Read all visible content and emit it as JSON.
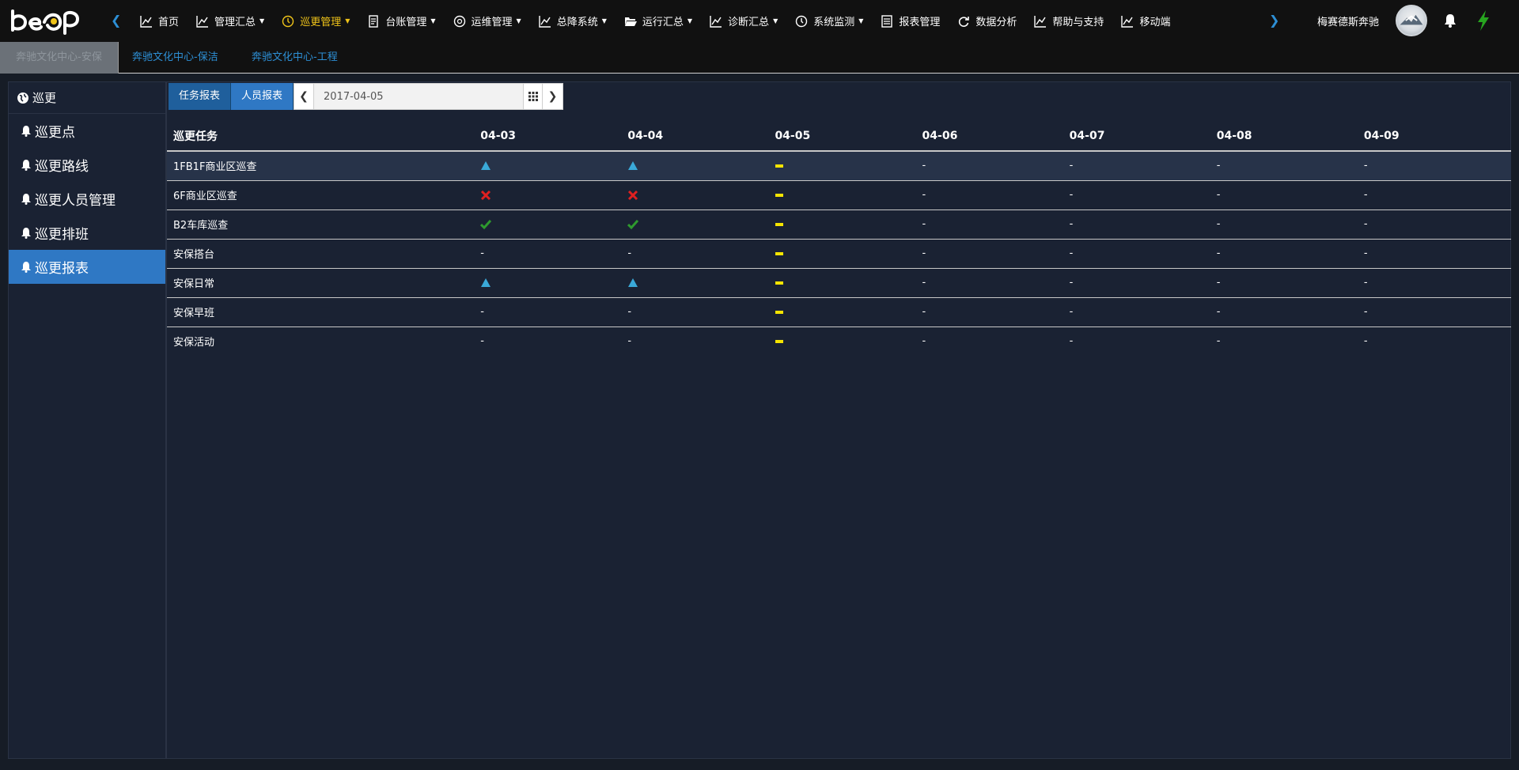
{
  "nav": {
    "items": [
      {
        "label": "首页",
        "icon": "chart-line-icon",
        "caret": false,
        "active": false
      },
      {
        "label": "管理汇总",
        "icon": "chart-line-icon",
        "caret": true,
        "active": false
      },
      {
        "label": "巡更管理",
        "icon": "clock-icon",
        "caret": true,
        "active": true
      },
      {
        "label": "台账管理",
        "icon": "file-icon",
        "caret": true,
        "active": false
      },
      {
        "label": "运维管理",
        "icon": "gauge-icon",
        "caret": true,
        "active": false
      },
      {
        "label": "总降系统",
        "icon": "chart-line-icon",
        "caret": true,
        "active": false
      },
      {
        "label": "运行汇总",
        "icon": "folder-open-icon",
        "caret": true,
        "active": false
      },
      {
        "label": "诊断汇总",
        "icon": "chart-line-icon",
        "caret": true,
        "active": false
      },
      {
        "label": "系统监测",
        "icon": "clock-icon",
        "caret": true,
        "active": false
      },
      {
        "label": "报表管理",
        "icon": "list-icon",
        "caret": false,
        "active": false
      },
      {
        "label": "数据分析",
        "icon": "refresh-icon",
        "caret": false,
        "active": false
      },
      {
        "label": "帮助与支持",
        "icon": "chart-line-icon",
        "caret": false,
        "active": false
      },
      {
        "label": "移动端",
        "icon": "chart-line-icon",
        "caret": false,
        "active": false
      }
    ],
    "user_name": "梅赛德斯奔驰",
    "accent_color": "#f0c419",
    "link_color": "#2d8fd5"
  },
  "tabs": [
    {
      "label": "奔驰文化中心-安保",
      "active": true
    },
    {
      "label": "奔驰文化中心-保洁",
      "active": false
    },
    {
      "label": "奔驰文化中心-工程",
      "active": false
    }
  ],
  "sidebar": {
    "title": "巡更",
    "items": [
      {
        "label": "巡更点",
        "active": false
      },
      {
        "label": "巡更路线",
        "active": false
      },
      {
        "label": "巡更人员管理",
        "active": false
      },
      {
        "label": "巡更排班",
        "active": false
      },
      {
        "label": "巡更报表",
        "active": true
      }
    ]
  },
  "toolbar": {
    "task_report_label": "任务报表",
    "person_report_label": "人员报表",
    "date_value": "2017-04-05"
  },
  "table": {
    "task_header": "巡更任务",
    "dates": [
      "04-03",
      "04-04",
      "04-05",
      "04-06",
      "04-07",
      "04-08",
      "04-09"
    ],
    "rows": [
      {
        "task": "1FB1F商业区巡查",
        "cells": [
          "triangle",
          "triangle",
          "bar",
          "-",
          "-",
          "-",
          "-"
        ]
      },
      {
        "task": "6F商业区巡查",
        "cells": [
          "cross",
          "cross",
          "bar",
          "-",
          "-",
          "-",
          "-"
        ]
      },
      {
        "task": "B2车库巡查",
        "cells": [
          "check",
          "check",
          "bar",
          "-",
          "-",
          "-",
          "-"
        ]
      },
      {
        "task": "安保搭台",
        "cells": [
          "-",
          "-",
          "bar",
          "-",
          "-",
          "-",
          "-"
        ]
      },
      {
        "task": "安保日常",
        "cells": [
          "triangle",
          "triangle",
          "bar",
          "-",
          "-",
          "-",
          "-"
        ]
      },
      {
        "task": "安保早班",
        "cells": [
          "-",
          "-",
          "bar",
          "-",
          "-",
          "-",
          "-"
        ]
      },
      {
        "task": "安保活动",
        "cells": [
          "-",
          "-",
          "bar",
          "-",
          "-",
          "-",
          "-"
        ]
      }
    ],
    "status_colors": {
      "triangle": "#3aa9d8",
      "cross": "#e02020",
      "check": "#2e9a2e",
      "bar": "#f5e400"
    }
  }
}
